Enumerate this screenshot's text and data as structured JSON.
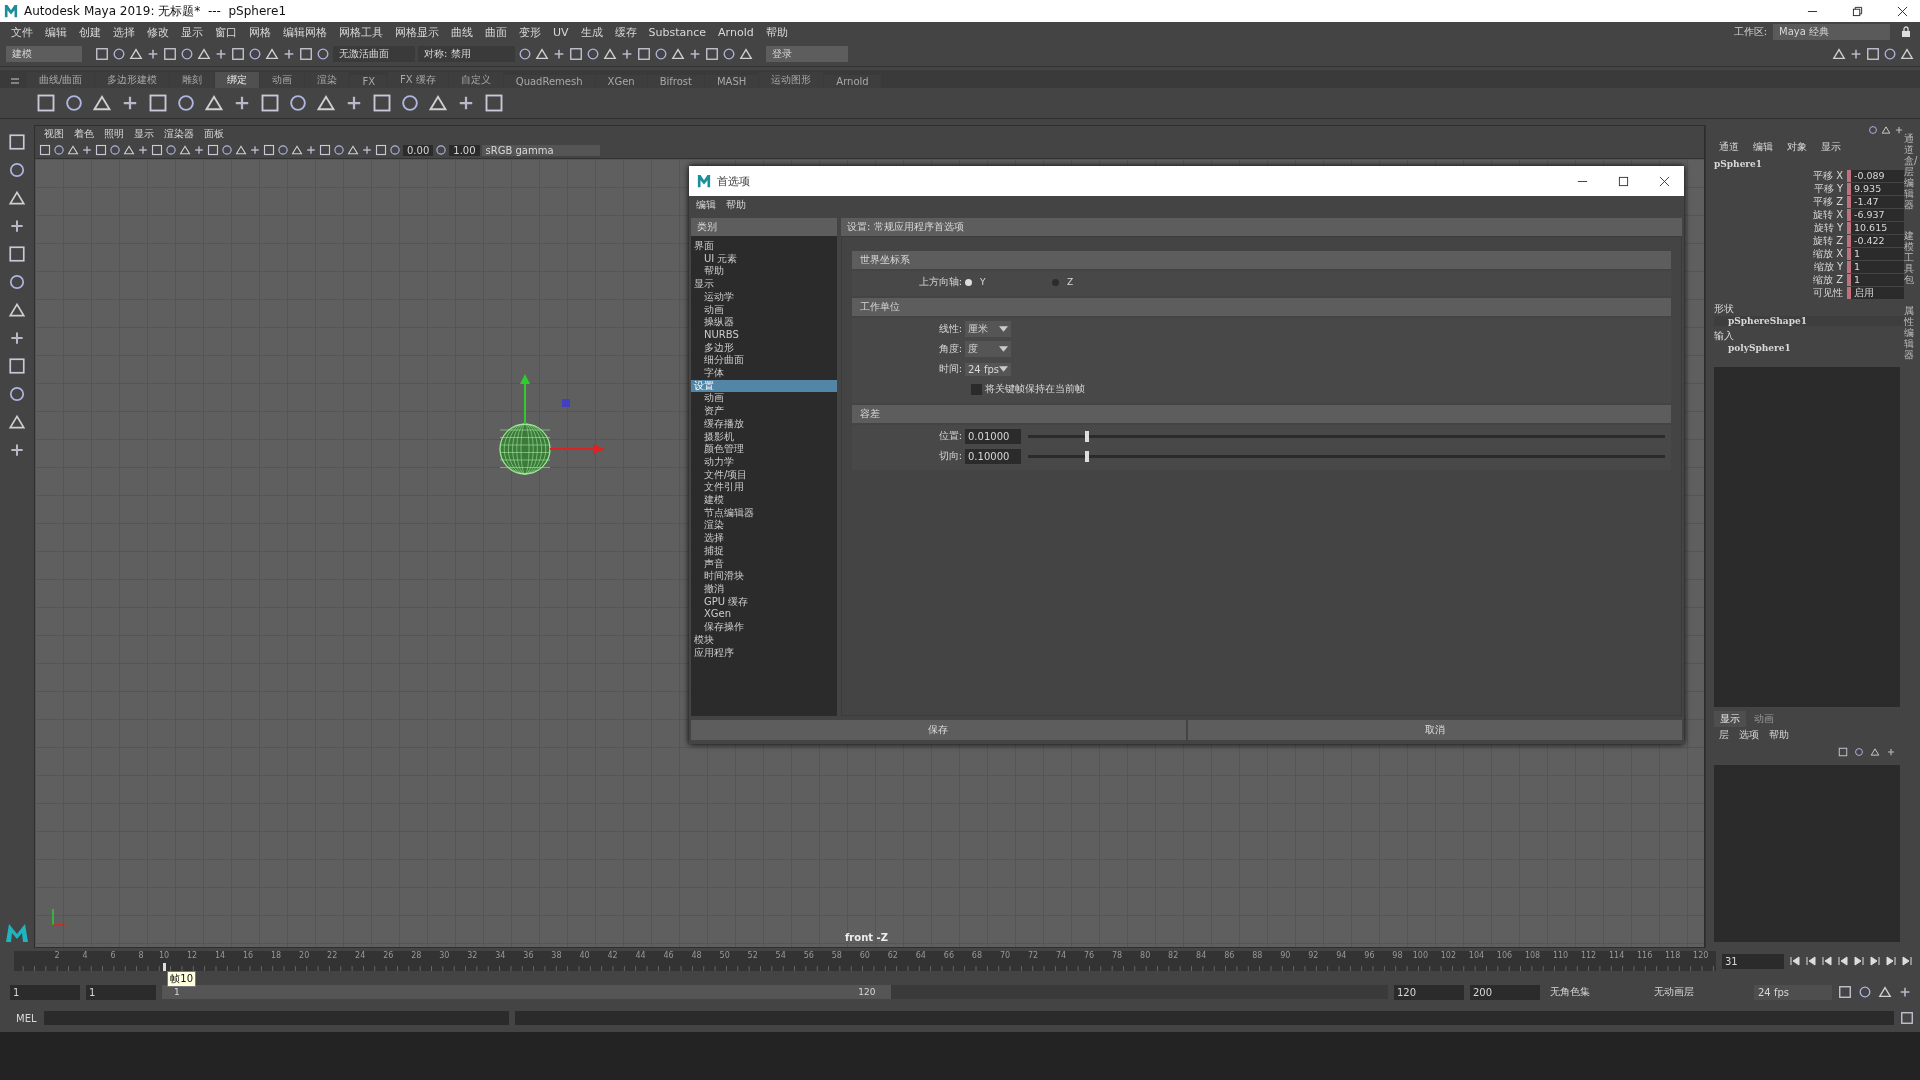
{
  "window": {
    "title": "Autodesk Maya 2019: 无标题*  ---  pSphere1"
  },
  "menu_bar": {
    "items": [
      "文件",
      "编辑",
      "创建",
      "选择",
      "修改",
      "显示",
      "窗口",
      "网格",
      "编辑网格",
      "网格工具",
      "网格显示",
      "曲线",
      "曲面",
      "变形",
      "UV",
      "生成",
      "缓存",
      "Substance",
      "Arnold",
      "帮助"
    ],
    "workspace_label": "工作区:",
    "workspace_value": "Maya 经典"
  },
  "status_line": {
    "menu_set": "建模",
    "surface_field": "无激活曲面",
    "symmetry": "对称: 禁用",
    "login": "登录"
  },
  "shelf": {
    "tabs": [
      {
        "label": "曲线/曲面",
        "selected": false
      },
      {
        "label": "多边形建模",
        "selected": false
      },
      {
        "label": "雕刻",
        "selected": false
      },
      {
        "label": "绑定",
        "selected": true
      },
      {
        "label": "动画",
        "selected": false
      },
      {
        "label": "渲染",
        "selected": false
      },
      {
        "label": "FX",
        "selected": false
      },
      {
        "label": "FX 缓存",
        "selected": false
      },
      {
        "label": "自定义",
        "selected": false
      },
      {
        "label": "QuadRemesh",
        "selected": false
      },
      {
        "label": "XGen",
        "selected": false
      },
      {
        "label": "Bifrost",
        "selected": false
      },
      {
        "label": "MASH",
        "selected": false
      },
      {
        "label": "运动图形",
        "selected": false
      },
      {
        "label": "Arnold",
        "selected": false
      }
    ]
  },
  "viewport": {
    "menu": [
      "视图",
      "着色",
      "照明",
      "显示",
      "渲染器",
      "面板"
    ],
    "exposure": "0.00",
    "gamma": "1.00",
    "color_space": "sRGB gamma",
    "camera_label": "front -Z"
  },
  "preferences": {
    "title": "首选项",
    "menu": [
      "编辑",
      "帮助"
    ],
    "category_heading": "类别",
    "panel_heading": "设置: 常规应用程序首选项",
    "categories": [
      {
        "label": "界面",
        "selected": false,
        "children": [
          {
            "label": "UI 元素",
            "selected": false
          },
          {
            "label": "帮助",
            "selected": false
          }
        ]
      },
      {
        "label": "显示",
        "selected": false,
        "children": [
          {
            "label": "运动学",
            "selected": false
          },
          {
            "label": "动画",
            "selected": false
          },
          {
            "label": "操纵器",
            "selected": false
          },
          {
            "label": "NURBS",
            "selected": false
          },
          {
            "label": "多边形",
            "selected": false
          },
          {
            "label": "细分曲面",
            "selected": false
          },
          {
            "label": "字体",
            "selected": false
          }
        ]
      },
      {
        "label": "设置",
        "selected": true,
        "children": [
          {
            "label": "动画",
            "selected": false
          },
          {
            "label": "资产",
            "selected": false
          },
          {
            "label": "缓存播放",
            "selected": false
          },
          {
            "label": "摄影机",
            "selected": false
          },
          {
            "label": "颜色管理",
            "selected": false
          },
          {
            "label": "动力学",
            "selected": false
          },
          {
            "label": "文件/项目",
            "selected": false
          },
          {
            "label": "文件引用",
            "selected": false
          },
          {
            "label": "建模",
            "selected": false
          },
          {
            "label": "节点编辑器",
            "selected": false
          },
          {
            "label": "渲染",
            "selected": false
          },
          {
            "label": "选择",
            "selected": false
          },
          {
            "label": "捕捉",
            "selected": false
          },
          {
            "label": "声音",
            "selected": false
          },
          {
            "label": "时间滑块",
            "selected": false
          },
          {
            "label": "撤消",
            "selected": false
          },
          {
            "label": "GPU 缓存",
            "selected": false
          },
          {
            "label": "XGen",
            "selected": false
          },
          {
            "label": "保存操作",
            "selected": false
          }
        ]
      },
      {
        "label": "模块",
        "selected": false
      },
      {
        "label": "应用程序",
        "selected": false
      }
    ],
    "sections": [
      {
        "title": "世界坐标系",
        "rows": [
          {
            "kind": "radio",
            "label": "上方向轴:",
            "options": [
              {
                "label": "Y",
                "selected": true
              },
              {
                "label": "Z",
                "selected": false
              }
            ]
          }
        ]
      },
      {
        "title": "工作单位",
        "rows": [
          {
            "kind": "dropdown",
            "label": "线性:",
            "value": "厘米"
          },
          {
            "kind": "dropdown",
            "label": "角度:",
            "value": "度"
          },
          {
            "kind": "dropdown",
            "label": "时间:",
            "value": "24 fps"
          },
          {
            "kind": "checkbox",
            "label": "将关键帧保持在当前帧",
            "checked": false
          }
        ]
      },
      {
        "title": "容差",
        "rows": [
          {
            "kind": "slider",
            "label": "位置:",
            "value": "0.01000",
            "level": 0.09
          },
          {
            "kind": "slider",
            "label": "切向:",
            "value": "0.10000",
            "level": 0.09
          }
        ]
      }
    ],
    "buttons": [
      "保存",
      "取消"
    ]
  },
  "channel_box": {
    "tabs": [
      "通道",
      "编辑",
      "对象",
      "显示"
    ],
    "object": "pSphere1",
    "channels": [
      {
        "name": "平移 X",
        "value": "-0.089"
      },
      {
        "name": "平移 Y",
        "value": "9.935"
      },
      {
        "name": "平移 Z",
        "value": "-1.47"
      },
      {
        "name": "旋转 X",
        "value": "-6.937"
      },
      {
        "name": "旋转 Y",
        "value": "10.615"
      },
      {
        "name": "旋转 Z",
        "value": "-0.422"
      },
      {
        "name": "缩放 X",
        "value": "1"
      },
      {
        "name": "缩放 Y",
        "value": "1"
      },
      {
        "name": "缩放 Z",
        "value": "1"
      },
      {
        "name": "可见性",
        "value": "启用"
      }
    ],
    "shape_heading": "形状",
    "shape": "pSphereShape1",
    "input_heading": "输入",
    "input": "polySphere1"
  },
  "layer_editor": {
    "tabs": [
      {
        "label": "显示",
        "selected": true
      },
      {
        "label": "动画",
        "selected": false
      }
    ],
    "menu": [
      "层",
      "选项",
      "帮助"
    ]
  },
  "side_tabs": [
    "通道盒/层编辑器",
    "建模工具包",
    "属性编辑器"
  ],
  "time_slider": {
    "ticks": [
      "2",
      "4",
      "6",
      "8",
      "10",
      "12",
      "14",
      "16",
      "18",
      "20",
      "22",
      "24",
      "26",
      "28",
      "30",
      "32",
      "34",
      "36",
      "38",
      "40",
      "42",
      "44",
      "46",
      "48",
      "50",
      "52",
      "54",
      "56",
      "58",
      "60",
      "62",
      "64",
      "66",
      "68",
      "70",
      "72",
      "74",
      "76",
      "78",
      "80",
      "82",
      "84",
      "86",
      "88",
      "90",
      "92",
      "94",
      "96",
      "98",
      "100",
      "102",
      "104",
      "106",
      "108",
      "110",
      "112",
      "114",
      "116",
      "118",
      "120"
    ],
    "level": 0.076,
    "tooltip": "帧10",
    "current_frame": "31"
  },
  "range_slider": {
    "level": 0.595,
    "start": "1",
    "playback_start": "1",
    "range_start_label": "1",
    "range_end_label": "120",
    "playback_end": "120",
    "end": "200",
    "character_set": "无角色集",
    "anim_layer": "无动画层",
    "fps": "24 fps"
  },
  "command_line": {
    "language": "MEL"
  }
}
